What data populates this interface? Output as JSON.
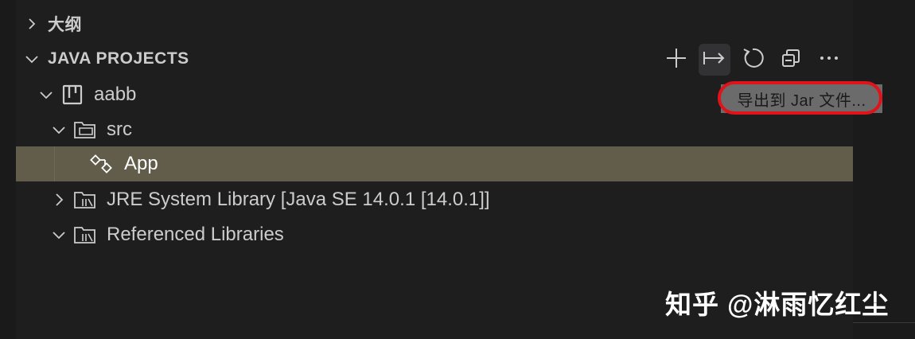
{
  "sections": {
    "outline": {
      "label": "大纲",
      "expanded": false
    },
    "java_projects": {
      "label": "JAVA PROJECTS",
      "expanded": true
    }
  },
  "toolbar": {
    "buttons": [
      {
        "icon": "plus-icon",
        "tooltip": ""
      },
      {
        "icon": "export-jar-icon",
        "tooltip": "导出到 Jar 文件..."
      },
      {
        "icon": "refresh-icon",
        "tooltip": ""
      },
      {
        "icon": "collapse-all-icon",
        "tooltip": ""
      },
      {
        "icon": "more-actions-icon",
        "tooltip": ""
      }
    ]
  },
  "tooltip": {
    "text": "导出到 Jar 文件..."
  },
  "tree": {
    "project": {
      "label": "aabb",
      "icon": "project-icon",
      "expanded": true
    },
    "src": {
      "label": "src",
      "icon": "source-folder-icon",
      "expanded": true
    },
    "app": {
      "label": "App",
      "icon": "java-class-icon",
      "selected": true
    },
    "jre": {
      "label": "JRE System Library [Java SE 14.0.1 [14.0.1]]",
      "icon": "library-icon",
      "expanded": false
    },
    "refs": {
      "label": "Referenced Libraries",
      "icon": "library-icon",
      "expanded": true
    }
  },
  "watermark": {
    "text": "知乎 @淋雨忆红尘"
  },
  "colors": {
    "selection": "#625d4b",
    "tooltip_bg": "#6b6b6b",
    "highlight_ring": "#e0131a",
    "panel_bg": "#1e1e1e"
  }
}
